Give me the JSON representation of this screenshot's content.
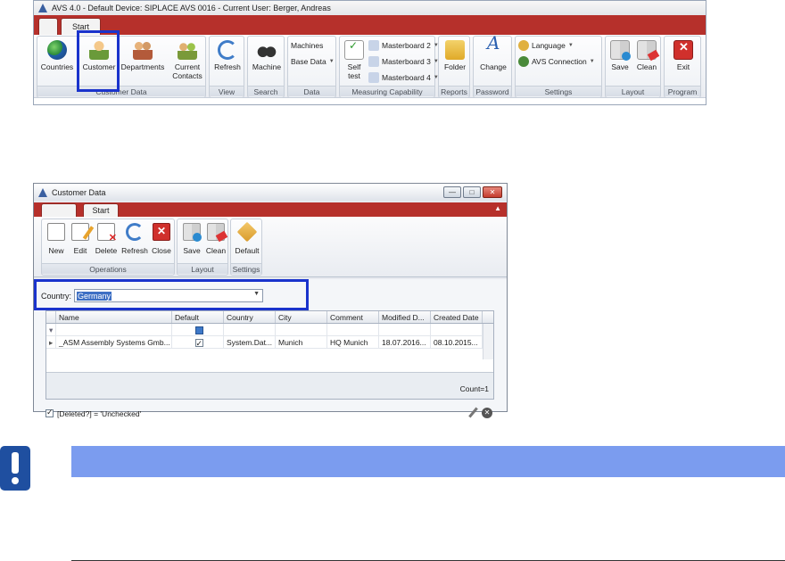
{
  "main_window": {
    "title": "AVS 4.0 - Default Device: SIPLACE AVS 0016 - Current User: Berger, Andreas",
    "tab": "Start",
    "groups": {
      "customer_data": "Customer Data",
      "view": "View",
      "search": "Search",
      "data": "Data",
      "measuring": "Measuring Capability",
      "reports": "Reports",
      "password": "Password",
      "settings": "Settings",
      "layout": "Layout",
      "program": "Program"
    },
    "buttons": {
      "countries": "Countries",
      "customer": "Customer",
      "departments": "Departments",
      "current": "Current",
      "contacts": "Contacts",
      "refresh": "Refresh",
      "machine": "Machine",
      "machines": "Machines",
      "base_data": "Base Data",
      "self": "Self",
      "test": "test",
      "masterboard2": "Masterboard 2",
      "masterboard3": "Masterboard 3",
      "masterboard4": "Masterboard 4",
      "folder": "Folder",
      "change": "Change",
      "language": "Language",
      "avs_connection": "AVS Connection",
      "save": "Save",
      "clean": "Clean",
      "exit": "Exit"
    }
  },
  "customer_window": {
    "title": "Customer Data",
    "tab": "Start",
    "groups": {
      "operations": "Operations",
      "layout": "Layout",
      "settings": "Settings"
    },
    "buttons": {
      "new": "New",
      "edit": "Edit",
      "delete": "Delete",
      "refresh": "Refresh",
      "close": "Close",
      "save": "Save",
      "clean": "Clean",
      "default": "Default"
    },
    "country_label": "Country:",
    "country_value": "Germany",
    "grid": {
      "columns": [
        "Name",
        "Default",
        "Country",
        "City",
        "Comment",
        "Modified D...",
        "Created Date"
      ],
      "rows": [
        {
          "name": "_ASM Assembly Systems Gmb...",
          "default": true,
          "country": "System.Dat...",
          "city": "Munich",
          "comment": "HQ Munich",
          "modified": "18.07.2016...",
          "created": "08.10.2015..."
        }
      ],
      "count": "Count=1"
    },
    "filter_text": "[Deleted?] = 'Unchecked'"
  },
  "colors": {
    "ribbon_red": "#b6302b",
    "highlight": "#1a33cc",
    "note_blue": "#7b9cef"
  }
}
